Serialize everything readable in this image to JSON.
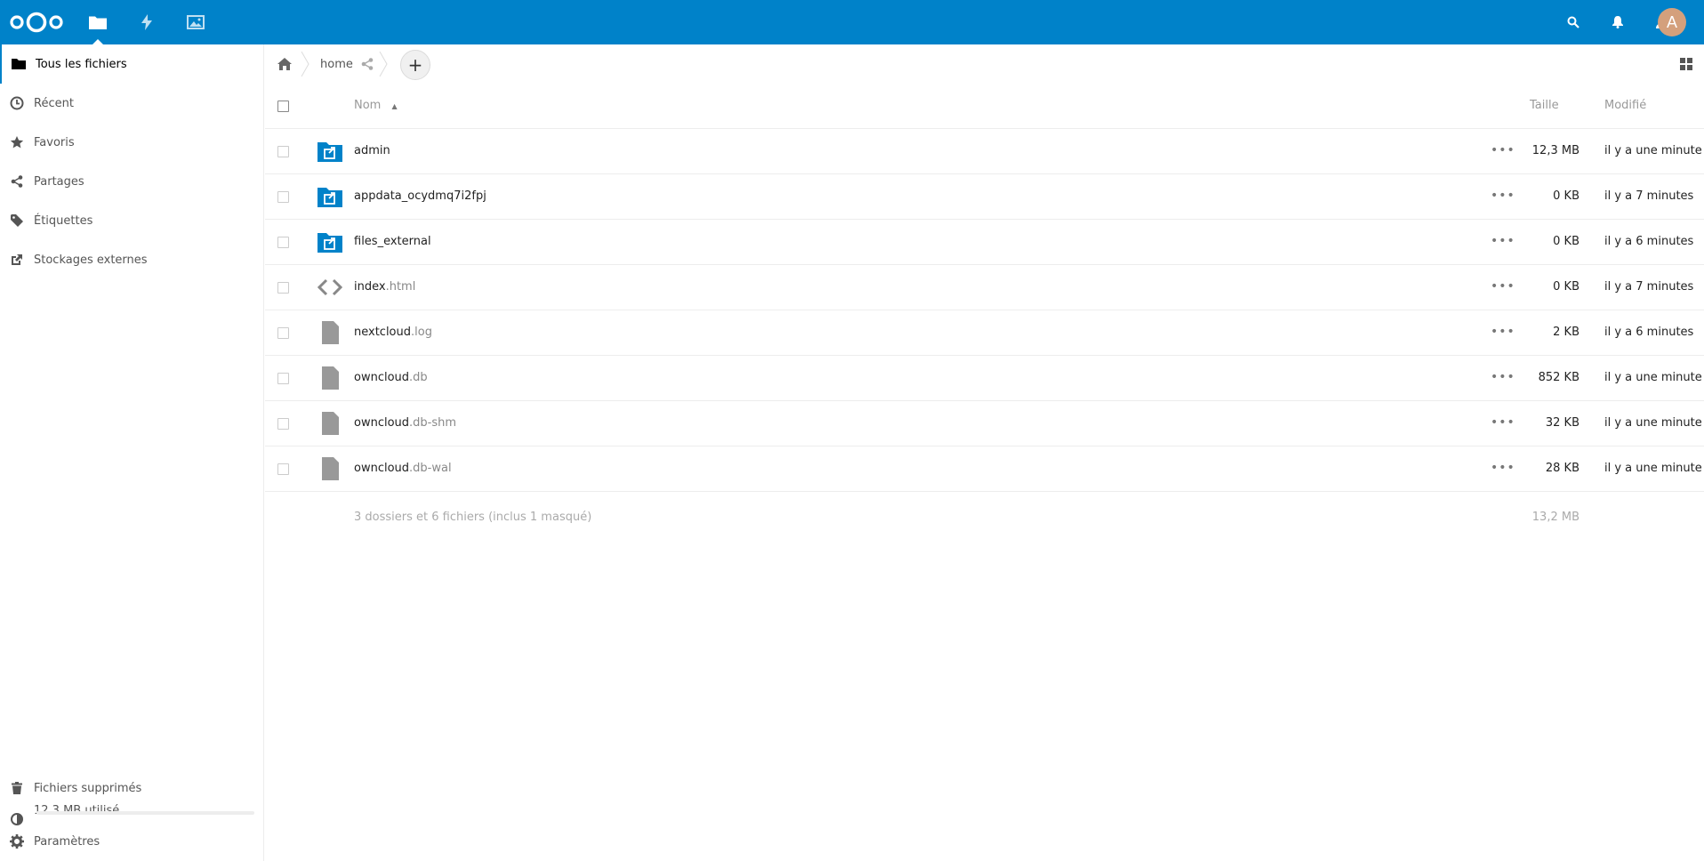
{
  "header": {
    "apps": [
      {
        "name": "files",
        "icon": "folder-icon"
      },
      {
        "name": "activity",
        "icon": "activity-icon"
      },
      {
        "name": "gallery",
        "icon": "image-icon"
      }
    ],
    "avatar_initial": "A",
    "accent": "#0082c9"
  },
  "sidebar": {
    "items": [
      {
        "label": "Tous les fichiers",
        "icon": "folder-icon"
      },
      {
        "label": "Récent",
        "icon": "clock-icon"
      },
      {
        "label": "Favoris",
        "icon": "star-icon"
      },
      {
        "label": "Partages",
        "icon": "share-icon"
      },
      {
        "label": "Étiquettes",
        "icon": "tag-icon"
      },
      {
        "label": "Stockages externes",
        "icon": "external-link-icon"
      }
    ],
    "deleted_label": "Fichiers supprimés",
    "quota_label": "12.3 MB utilisé",
    "quota_fraction": 0.0,
    "settings_label": "Paramètres"
  },
  "controls": {
    "crumb_home": "home"
  },
  "table": {
    "columns": {
      "name": "Nom",
      "size": "Taille",
      "modified": "Modifié"
    },
    "rows": [
      {
        "base": "admin",
        "ext": "",
        "type": "folder-external",
        "size": "12,3 MB",
        "modified": "il y a une minute"
      },
      {
        "base": "appdata_ocydmq7i2fpj",
        "ext": "",
        "type": "folder-external",
        "size": "0 KB",
        "modified": "il y a 7 minutes"
      },
      {
        "base": "files_external",
        "ext": "",
        "type": "folder-external",
        "size": "0 KB",
        "modified": "il y a 6 minutes"
      },
      {
        "base": "index",
        "ext": ".html",
        "type": "code",
        "size": "0 KB",
        "modified": "il y a 7 minutes"
      },
      {
        "base": "nextcloud",
        "ext": ".log",
        "type": "file",
        "size": "2 KB",
        "modified": "il y a 6 minutes"
      },
      {
        "base": "owncloud",
        "ext": ".db",
        "type": "file",
        "size": "852 KB",
        "modified": "il y a une minute"
      },
      {
        "base": "owncloud",
        "ext": ".db-shm",
        "type": "file",
        "size": "32 KB",
        "modified": "il y a une minute"
      },
      {
        "base": "owncloud",
        "ext": ".db-wal",
        "type": "file",
        "size": "28 KB",
        "modified": "il y a une minute"
      }
    ],
    "summary": "3 dossiers et 6 fichiers (inclus 1 masqué)",
    "summary_size": "13,2 MB"
  }
}
